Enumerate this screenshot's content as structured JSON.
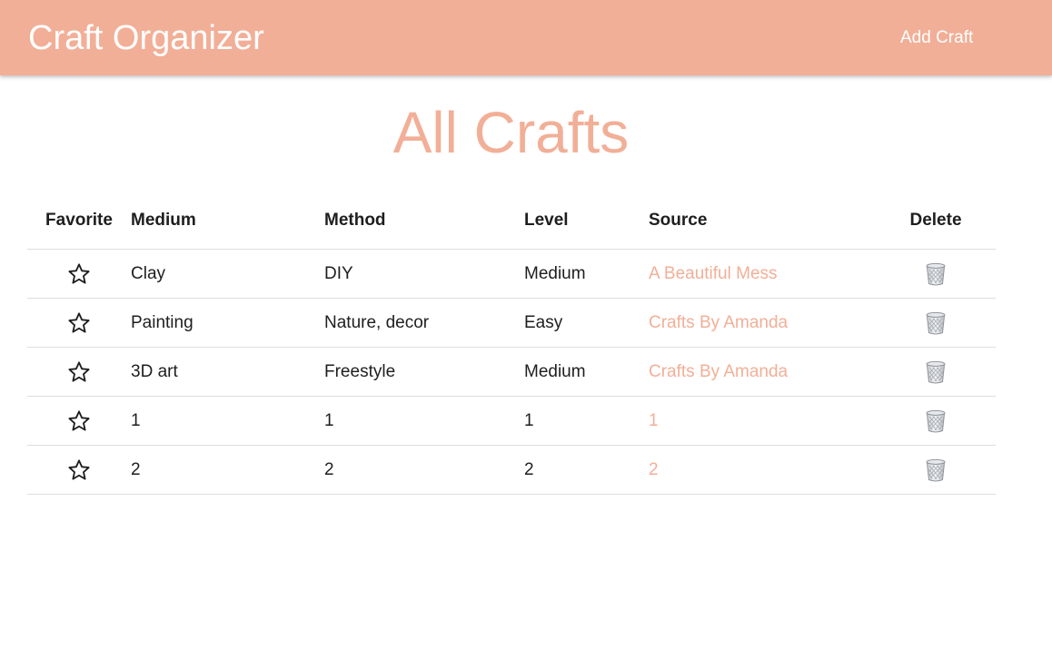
{
  "header": {
    "brand": "Craft Organizer",
    "add_link": "Add Craft"
  },
  "page": {
    "title": "All Crafts"
  },
  "table": {
    "columns": [
      "Favorite",
      "Medium",
      "Method",
      "Level",
      "Source",
      "Delete"
    ],
    "rows": [
      {
        "medium": "Clay",
        "method": "DIY",
        "level": "Medium",
        "source": "A Beautiful Mess"
      },
      {
        "medium": "Painting",
        "method": "Nature, decor",
        "level": "Easy",
        "source": "Crafts By Amanda"
      },
      {
        "medium": "3D art",
        "method": "Freestyle",
        "level": "Medium",
        "source": "Crafts By Amanda"
      },
      {
        "medium": "1",
        "method": "1",
        "level": "1",
        "source": "1"
      },
      {
        "medium": "2",
        "method": "2",
        "level": "2",
        "source": "2"
      }
    ]
  },
  "icons": {
    "favorite": "star-outline-icon",
    "delete": "trash-can-icon"
  },
  "colors": {
    "accent": "#f2af97",
    "text": "#1e1e1e",
    "divider": "#dedede"
  }
}
